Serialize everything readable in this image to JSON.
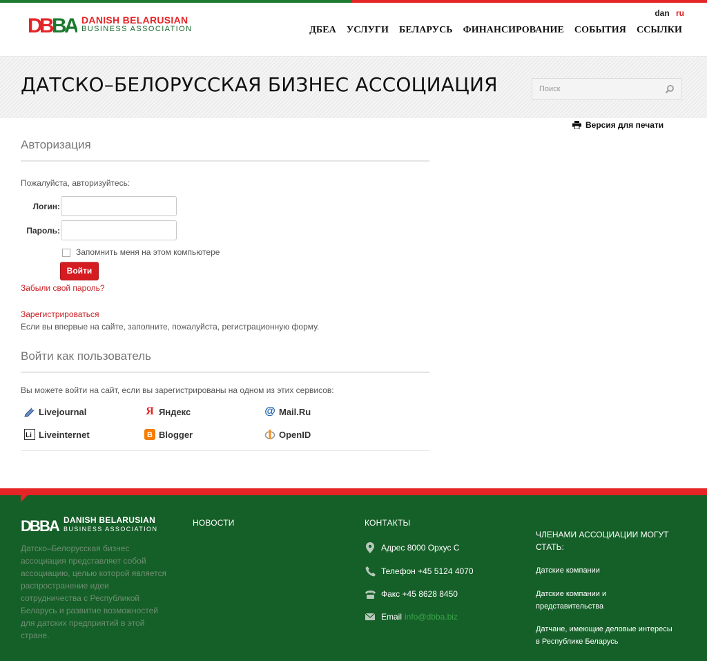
{
  "brand": {
    "line1": "DANISH BELARUSIAN",
    "line2": "BUSINESS ASSOCIATION",
    "colors": {
      "red": "#e52425",
      "green": "#1b7a2e",
      "footer": "#155f28"
    }
  },
  "lang": {
    "dan": "dan",
    "ru": "ru",
    "active": "ru"
  },
  "nav": [
    "ДБЕА",
    "УСЛУГИ",
    "БЕЛАРУСЬ",
    "ФИНАНСИРОВАНИЕ",
    "СОБЫТИЯ",
    "ССЫЛКИ"
  ],
  "page": {
    "title": "ДАТСКО–БЕЛОРУССКАЯ БИЗНЕС АССОЦИАЦИЯ",
    "search_placeholder": "Поиск",
    "print_label": "Версия для печати"
  },
  "auth": {
    "title": "Авторизация",
    "prompt": "Пожалуйста, авторизуйтесь:",
    "login_label": "Логин:",
    "password_label": "Пароль:",
    "remember_label": "Запомнить меня на этом компьютере",
    "submit_label": "Войти",
    "forgot_link": "Забыли свой пароль?",
    "register_link": "Зарегистрироваться",
    "register_note": "Если вы впервые на сайте, заполните, пожалуйста, регистрационную форму."
  },
  "social": {
    "title": "Войти как пользователь",
    "note": "Вы можете войти на сайт, если вы зарегистрированы на одном из этих сервисов:",
    "providers": [
      {
        "name": "Livejournal",
        "icon": "livejournal-icon"
      },
      {
        "name": "Яндекс",
        "icon": "yandex-icon"
      },
      {
        "name": "Mail.Ru",
        "icon": "mailru-icon"
      },
      {
        "name": "Liveinternet",
        "icon": "liveinternet-icon"
      },
      {
        "name": "Blogger",
        "icon": "blogger-icon"
      },
      {
        "name": "OpenID",
        "icon": "openid-icon"
      }
    ]
  },
  "footer": {
    "description": "Датско–Белорусская бизнес ассоциация представляет собой ассоциацию, целью которой является распространение идеи сотрудничества с Республикой Беларусь и развитие возможностей для датских предприятий в этой стране.",
    "news_heading": "НОВОСТИ",
    "contacts_heading": "КОНТАКТЫ",
    "address": "Адрес 8000 Орхус С",
    "phone": "Телефон +45 5124 4070",
    "fax": "Факс +45 8628 8450",
    "email_label": "Email",
    "email": "info@dbba.biz",
    "members_heading": "ЧЛЕНАМИ АССОЦИАЦИИ МОГУТ СТАТЬ:",
    "members": [
      "Датские компании",
      "Датские компании и представительства",
      "Датчане, имеющие деловые интересы в Республике Беларусь"
    ]
  }
}
